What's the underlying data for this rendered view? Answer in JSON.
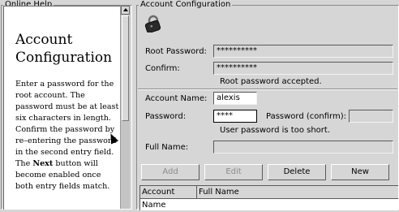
{
  "help": {
    "frame_title": "Online Help",
    "heading": "Account Configuration",
    "body_before_next": "Enter a password for the root account. The password must be at least six characters in length. Confirm the password by re–entering the password in the second entry field. The ",
    "body_next": "Next",
    "body_after_next": " button will become enabled once both entry fields match."
  },
  "config": {
    "frame_title": "Account Configuration",
    "root_password_label": "Root Password:",
    "root_password_value": "**********",
    "confirm_label": "Confirm:",
    "confirm_value": "**********",
    "root_status": "Root password accepted.",
    "account_name_label": "Account Name:",
    "account_name_value": "alexis",
    "password_label": "Password:",
    "password_value": "****",
    "password_confirm_label": "Password (confirm):",
    "password_confirm_value": "",
    "user_status": "User password is too short.",
    "full_name_label": "Full Name:",
    "full_name_value": "",
    "buttons": {
      "add": "Add",
      "edit": "Edit",
      "delete": "Delete",
      "new": "New"
    },
    "table": {
      "columns": [
        "Account Name",
        "Full Name"
      ]
    }
  }
}
